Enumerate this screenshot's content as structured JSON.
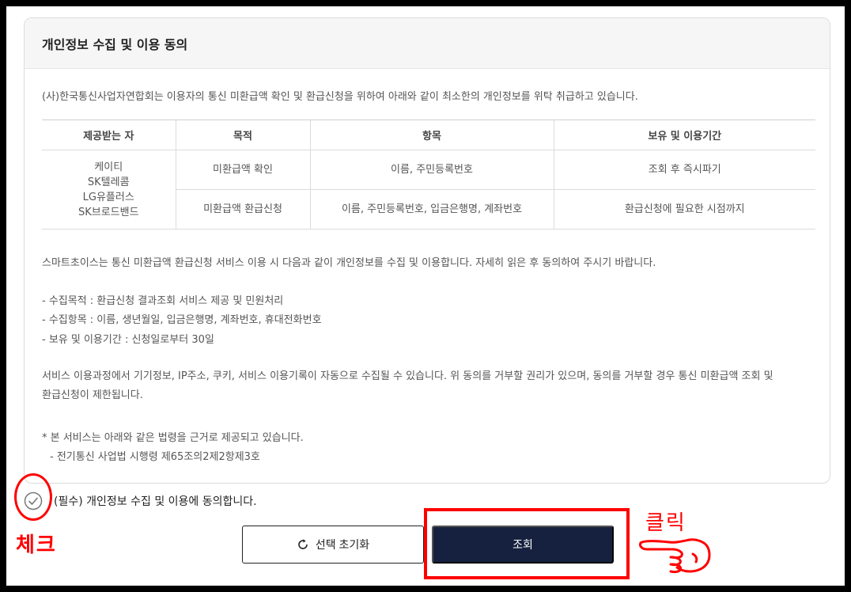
{
  "panel": {
    "title": "개인정보 수집 및 이용 동의",
    "intro": "(사)한국통신사업자연합회는 이용자의 통신 미환급액 확인 및 환급신청을 위하여 아래와 같이 최소한의 개인정보를 위탁 취급하고 있습니다.",
    "table": {
      "headers": [
        "제공받는 자",
        "목적",
        "항목",
        "보유 및 이용기간"
      ],
      "provider_lines": [
        "케이티",
        "SK텔레콤",
        "LG유플러스",
        "SK브로드밴드"
      ],
      "rows": [
        {
          "purpose": "미환급액 확인",
          "items": "이름, 주민등록번호",
          "period": "조회 후 즉시파기"
        },
        {
          "purpose": "미환급액 환급신청",
          "items": "이름, 주민등록번호, 입금은행명, 계좌번호",
          "period": "환급신청에 필요한 시점까지"
        }
      ]
    },
    "notice": "스마트초이스는 통신 미환급액 환급신청 서비스 이용 시 다음과 같이 개인정보를 수집 및 이용합니다. 자세히 읽은 후 동의하여 주시기 바랍니다.",
    "list": [
      "- 수집목적 : 환급신청 결과조회 서비스 제공 및 민원처리",
      "- 수집항목 : 이름, 생년월일, 입금은행명, 계좌번호, 휴대전화번호",
      "- 보유 및 이용기간 : 신청일로부터 30일"
    ],
    "auto_collect_line1": "서비스 이용과정에서 기기정보, IP주소, 쿠키, 서비스 이용기록이 자동으로 수집될 수 있습니다. 위 동의를 거부할 권리가 있으며, 동의를 거부할 경우 통신 미환급액 조회 및",
    "auto_collect_line2": "환급신청이 제한됩니다.",
    "law_note": "* 본 서비스는 아래와 같은 법령을 근거로 제공되고 있습니다.",
    "law_item": "- 전기통신 사업법 시행령 제65조의2제2항제3호"
  },
  "consent": {
    "label": "(필수) 개인정보 수집 및 이용에 동의합니다."
  },
  "buttons": {
    "reset_label": "선택 초기화",
    "search_label": "조회"
  },
  "annotations": {
    "check_label": "체크",
    "click_label": "클릭",
    "color": "#ff0000"
  },
  "icons": {
    "check": "check-circle-icon",
    "reset": "refresh-icon",
    "hand": "pointing-hand-icon"
  }
}
